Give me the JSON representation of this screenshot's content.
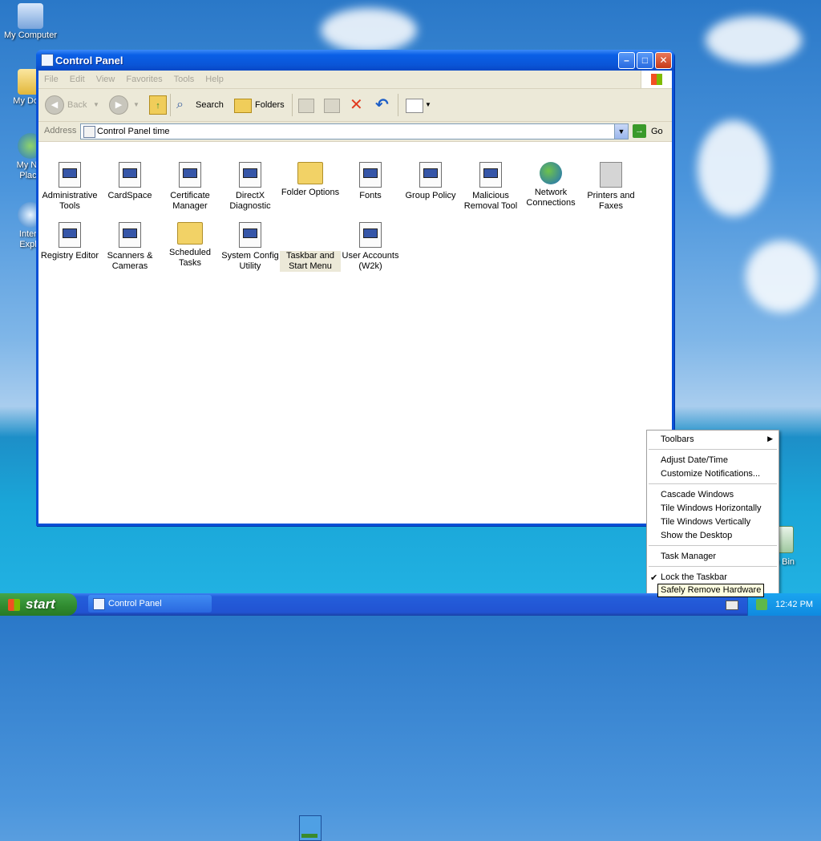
{
  "desktop": {
    "icons": [
      {
        "label": "My Computer"
      },
      {
        "label": "My Docu"
      },
      {
        "label": "My Net"
      },
      {
        "label": "Place"
      },
      {
        "label": "Intern"
      },
      {
        "label": "Explo"
      }
    ],
    "recycle_bin_label": "cle Bin"
  },
  "window": {
    "title": "Control Panel",
    "buttons": {
      "minimize": "–",
      "maximize": "□",
      "close": "✕"
    },
    "menu": [
      "File",
      "Edit",
      "View",
      "Favorites",
      "Tools",
      "Help"
    ],
    "toolbar": {
      "back": "Back",
      "search": "Search",
      "folders": "Folders"
    },
    "address": {
      "label": "Address",
      "value": "Control Panel time",
      "go": "Go"
    },
    "items": [
      {
        "line1": "Administrative",
        "line2": "Tools"
      },
      {
        "line1": "CardSpace",
        "line2": ""
      },
      {
        "line1": "Certificate",
        "line2": "Manager"
      },
      {
        "line1": "DirectX",
        "line2": "Diagnostic"
      },
      {
        "line1": "Folder Options",
        "line2": ""
      },
      {
        "line1": "Fonts",
        "line2": ""
      },
      {
        "line1": "Group Policy",
        "line2": ""
      },
      {
        "line1": "Malicious",
        "line2": "Removal Tool"
      },
      {
        "line1": "Network",
        "line2": "Connections"
      },
      {
        "line1": "Printers and",
        "line2": "Faxes"
      },
      {
        "line1": "Registry Editor",
        "line2": ""
      },
      {
        "line1": "Scanners &",
        "line2": "Cameras"
      },
      {
        "line1": "Scheduled",
        "line2": "Tasks"
      },
      {
        "line1": "System Config",
        "line2": "Utility"
      },
      {
        "line1": "Taskbar and",
        "line2": "Start Menu"
      },
      {
        "line1": "User Accounts",
        "line2": "(W2k)"
      }
    ]
  },
  "context_menu": {
    "toolbars": "Toolbars",
    "adjust_datetime": "Adjust Date/Time",
    "customize_notifications": "Customize Notifications...",
    "cascade": "Cascade Windows",
    "tile_h": "Tile Windows Horizontally",
    "tile_v": "Tile Windows Vertically",
    "show_desktop": "Show the Desktop",
    "task_manager": "Task Manager",
    "lock_taskbar": "Lock the Taskbar"
  },
  "tooltip": "Safely Remove Hardware",
  "taskbar": {
    "start": "start",
    "task_button": "Control Panel",
    "clock": "12:42 PM"
  }
}
